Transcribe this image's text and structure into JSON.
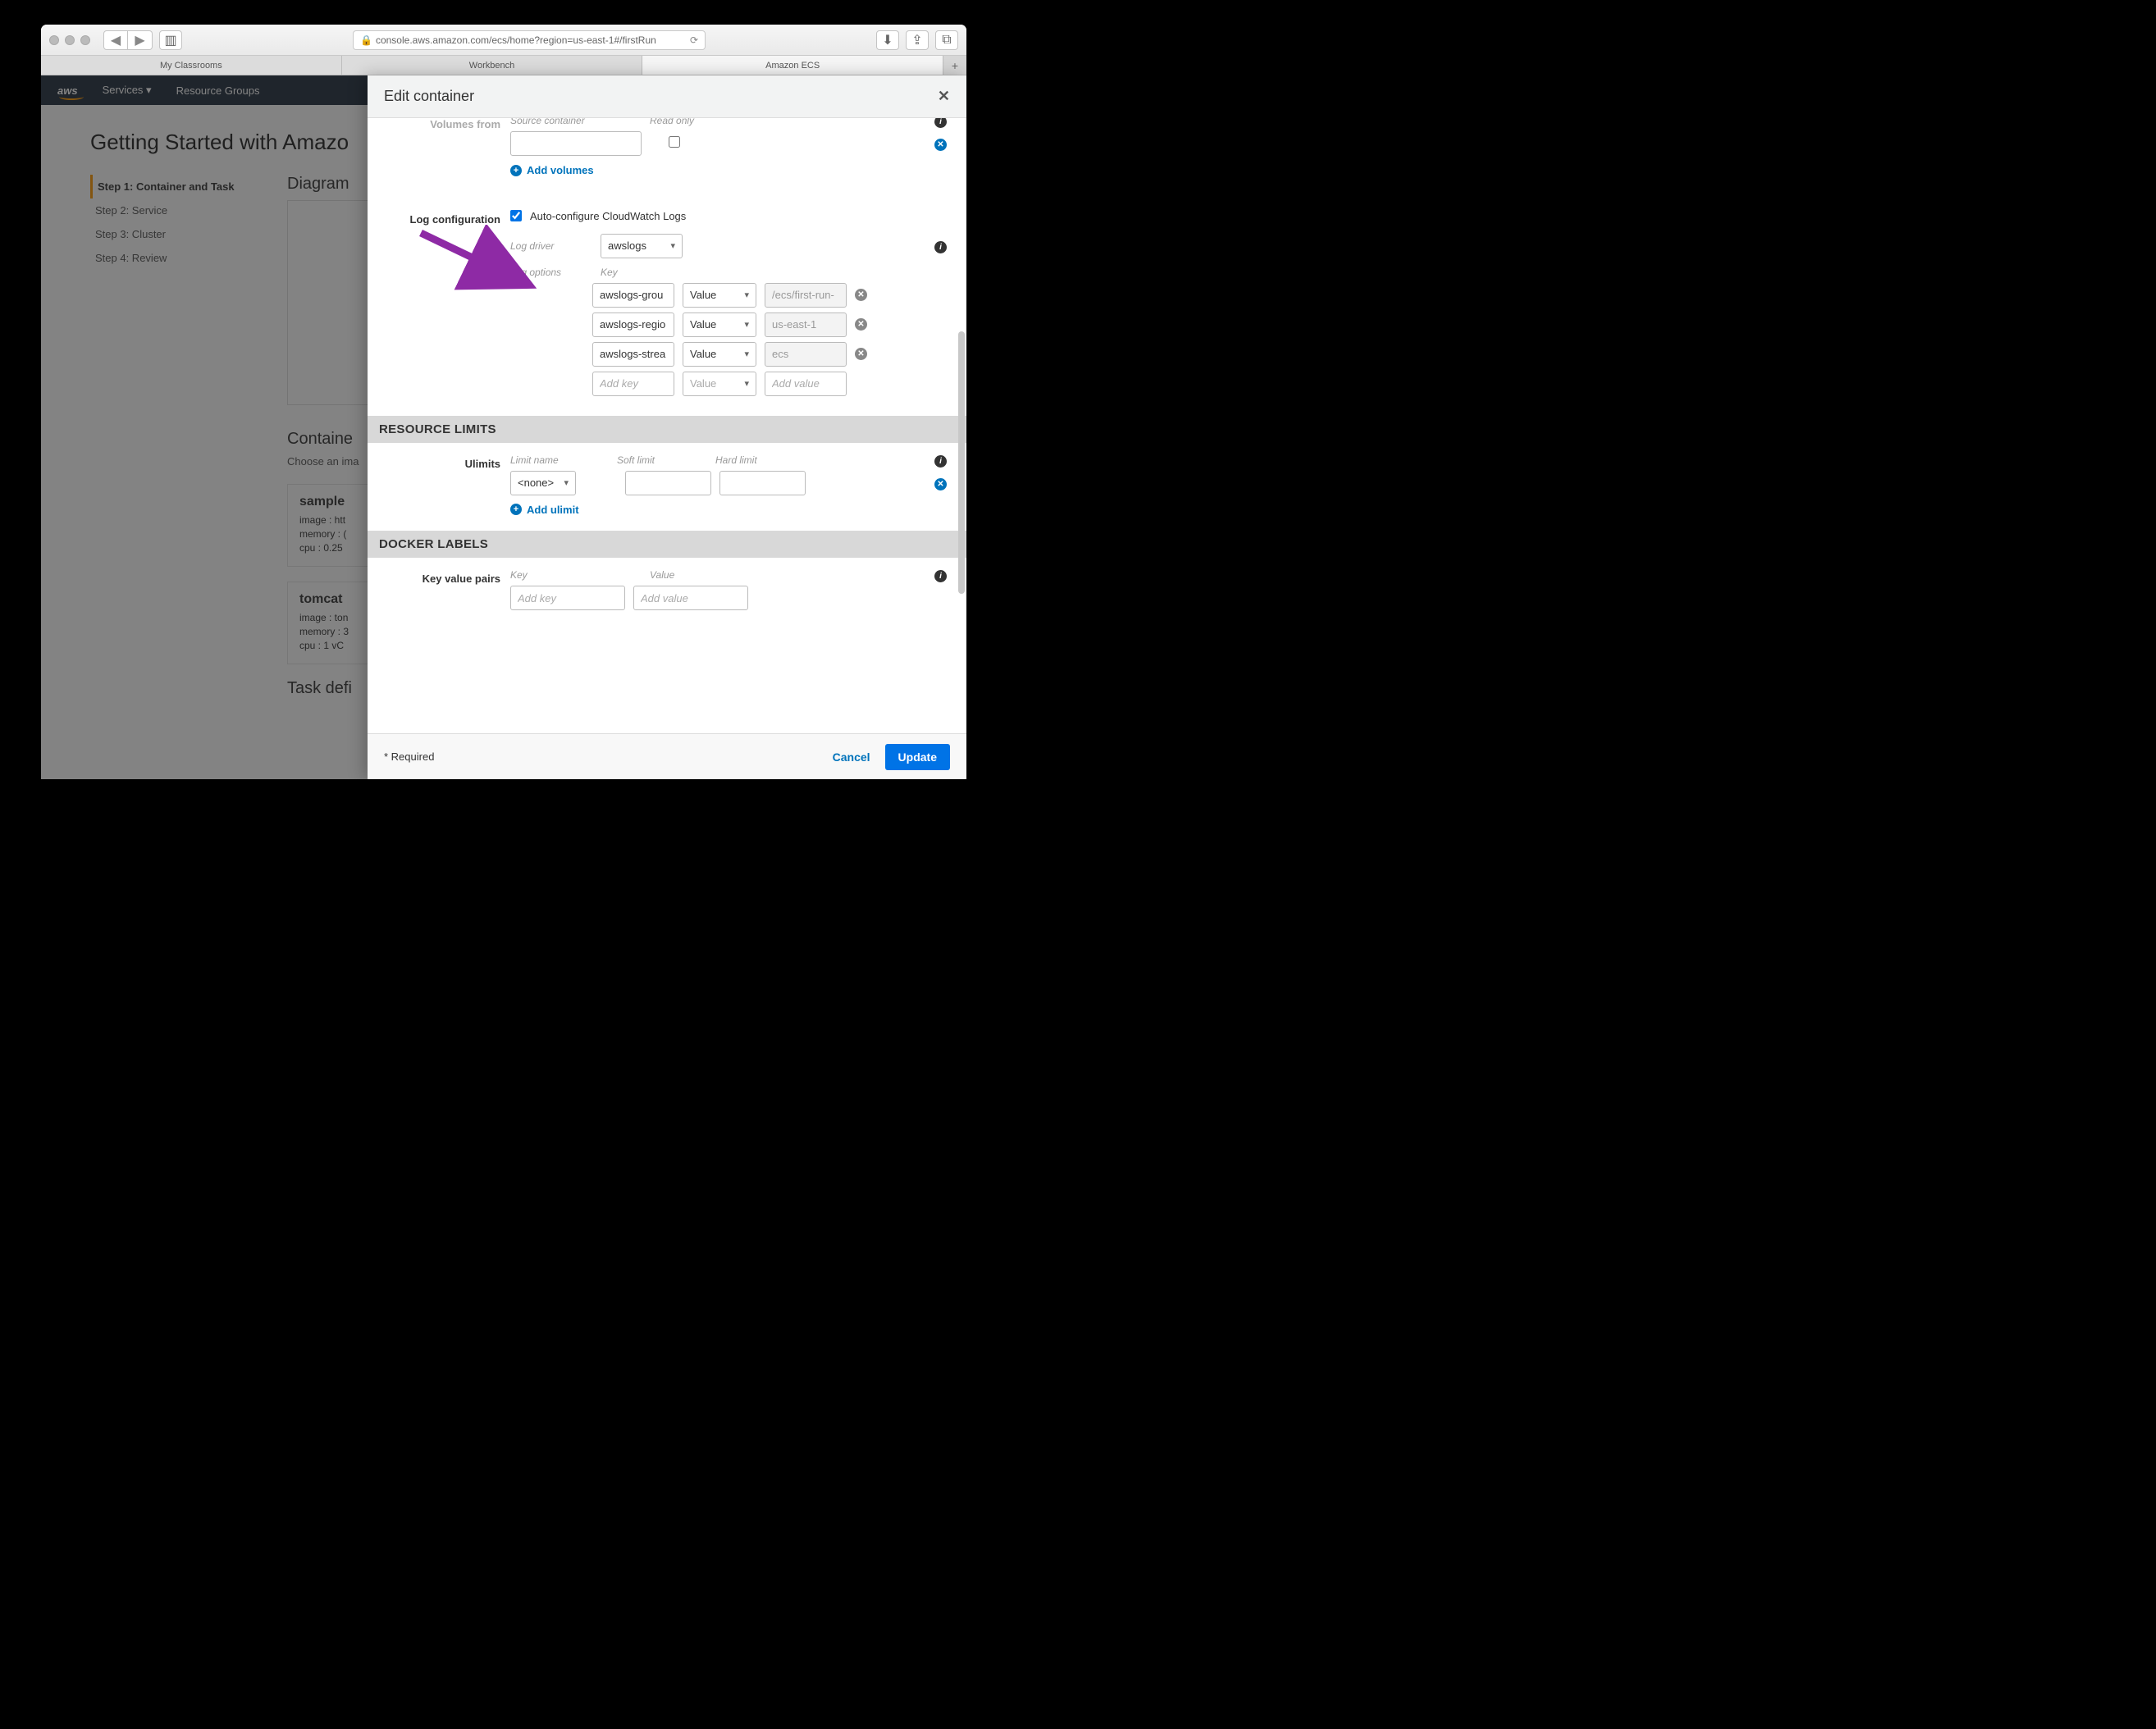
{
  "browser": {
    "url": "console.aws.amazon.com/ecs/home?region=us-east-1#/firstRun",
    "tabs": [
      "My Classrooms",
      "Workbench",
      "Amazon ECS"
    ]
  },
  "awsNav": {
    "logo": "aws",
    "services": "Services",
    "resourceGroups": "Resource Groups"
  },
  "page": {
    "title": "Getting Started with Amazo",
    "steps": [
      "Step 1: Container and Task",
      "Step 2: Service",
      "Step 3: Cluster",
      "Step 4: Review"
    ],
    "diagramHeading": "Diagram",
    "containerHeading": "Containe",
    "containerSub": "Choose an ima",
    "taskHeading": "Task defi",
    "cards": [
      {
        "title": "sample",
        "image": "image : htt",
        "memory": "memory :  (",
        "cpu": "cpu :  0.25"
      },
      {
        "title": "tomcat",
        "image": "image : ton",
        "memory": "memory :  3",
        "cpu": "cpu :  1 vC"
      }
    ]
  },
  "modal": {
    "title": "Edit container",
    "volumesFrom": {
      "label": "Volumes from",
      "col1": "Source container",
      "col2": "Read only",
      "addLink": "Add volumes"
    },
    "logConfig": {
      "label": "Log configuration",
      "auto": "Auto-configure CloudWatch Logs",
      "driverLabel": "Log driver",
      "driverValue": "awslogs",
      "optionsLabel": "Log options",
      "keyHeader": "Key",
      "valueDropdown": "Value",
      "rows": [
        {
          "key": "awslogs-grou",
          "val": "/ecs/first-run-"
        },
        {
          "key": "awslogs-regio",
          "val": "us-east-1"
        },
        {
          "key": "awslogs-strea",
          "val": "ecs"
        }
      ],
      "addKeyPh": "Add key",
      "addValPh": "Add value"
    },
    "resourceLimits": {
      "heading": "RESOURCE LIMITS",
      "ulimitsLabel": "Ulimits",
      "col1": "Limit name",
      "col2": "Soft limit",
      "col3": "Hard limit",
      "noneOption": "<none>",
      "addLink": "Add ulimit"
    },
    "dockerLabels": {
      "heading": "DOCKER LABELS",
      "kvLabel": "Key value pairs",
      "col1": "Key",
      "col2": "Value",
      "keyPh": "Add key",
      "valPh": "Add value"
    },
    "footer": {
      "required": "* Required",
      "cancel": "Cancel",
      "update": "Update"
    }
  }
}
